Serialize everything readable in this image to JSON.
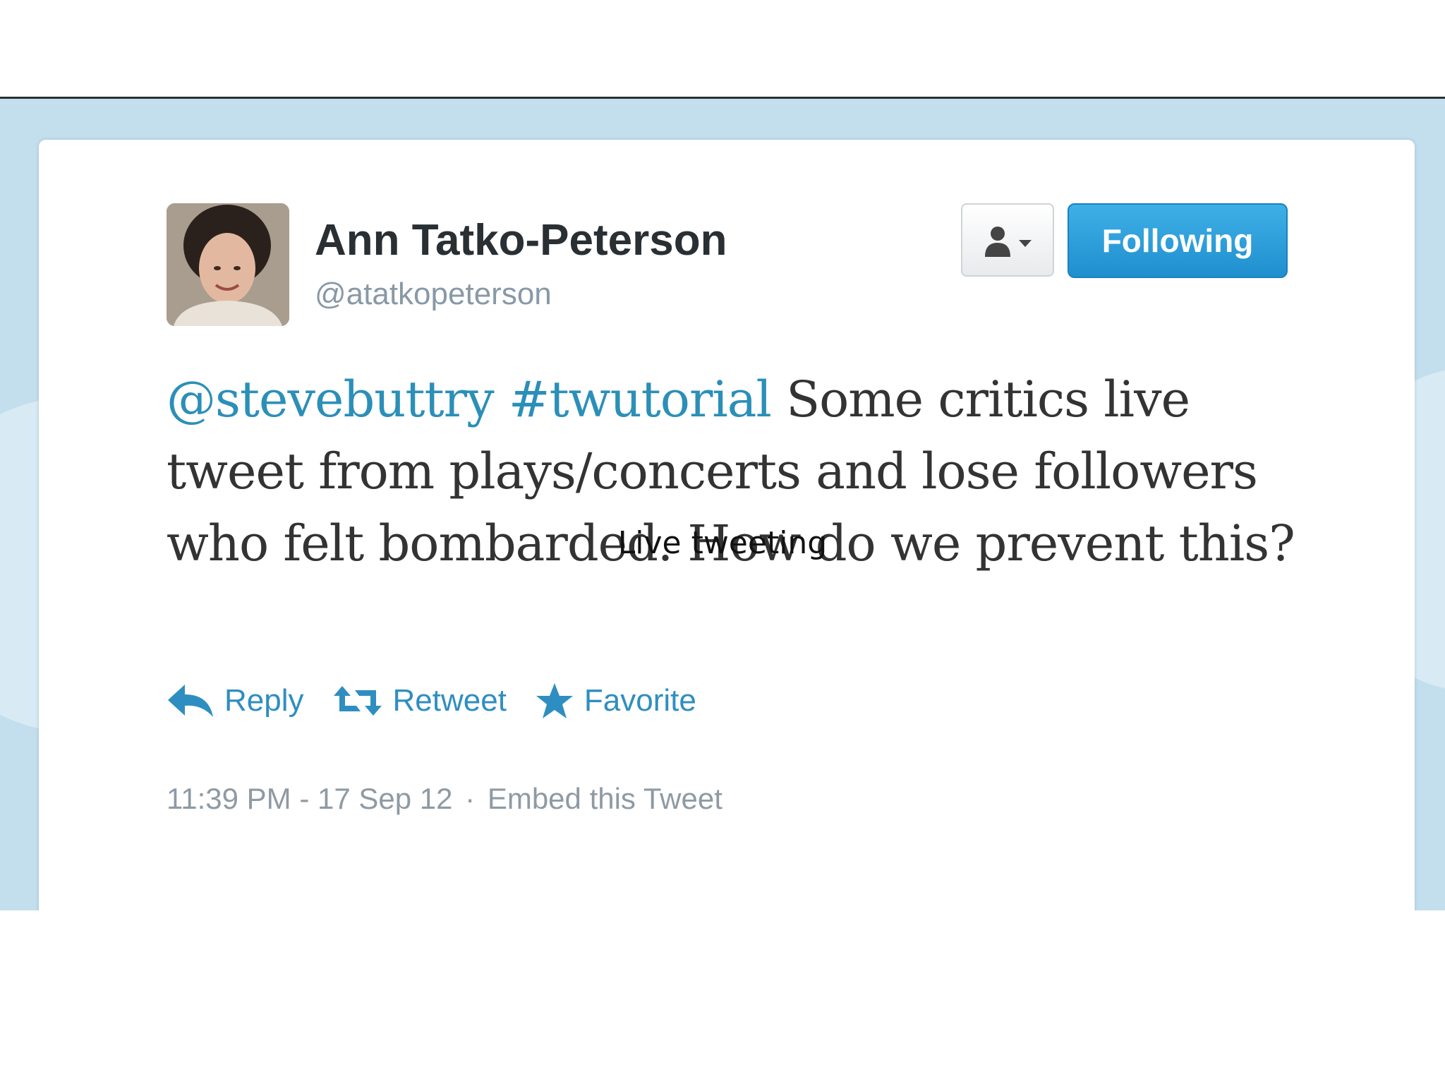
{
  "tweet": {
    "display_name": "Ann Tatko-Peterson",
    "handle": "@atatkopeterson",
    "follow_label": "Following",
    "text_mention": "@stevebuttry",
    "text_hashtag": "#twutorial",
    "text_body": "Some critics live tweet from plays/concerts and lose followers who felt bombarded. How do we prevent this?",
    "actions": {
      "reply": "Reply",
      "retweet": "Retweet",
      "favorite": "Favorite"
    },
    "timestamp": "11:39 PM - 17 Sep 12",
    "separator": "·",
    "embed": "Embed this Tweet"
  },
  "icons": {
    "user_menu": "person-dropdown-icon",
    "reply": "reply-arrow-icon",
    "retweet": "retweet-icon",
    "favorite": "star-icon"
  },
  "colors": {
    "link": "#2b8fb8",
    "follow_button": "#2a9fdb",
    "page_background": "#c3dfee"
  },
  "slide": {
    "caption": "Live tweeting"
  }
}
